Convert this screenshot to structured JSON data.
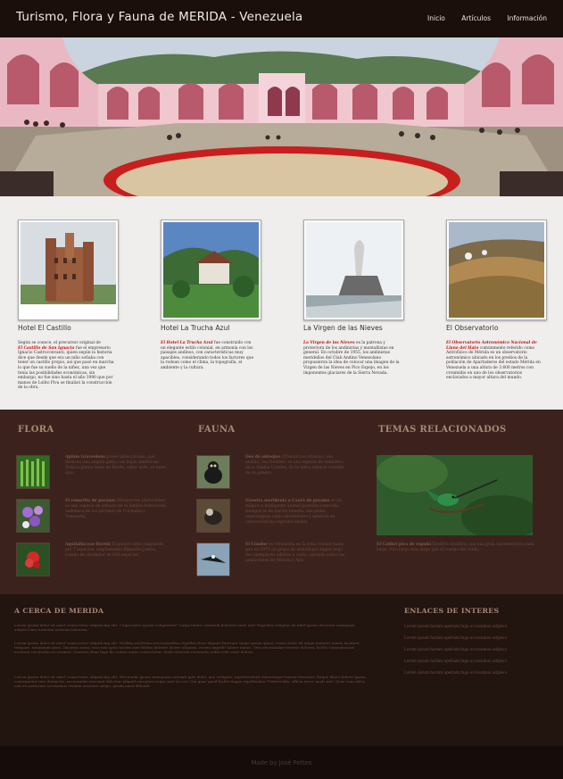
{
  "header": {
    "title": "Turismo, Flora y Fauna de MERIDA - Venezuela",
    "nav": [
      "Inicio",
      "Artículos",
      "Información"
    ]
  },
  "hotels": [
    {
      "name": "Hotel El Castillo",
      "pre": "Según se conoce, el precursor original de",
      "highlight": "El Castillo de San Ignacio",
      "post": "fue el empresario Ignacio Castroconvanti, quien según la historia dice que desde que era un niño soñaba con tener un castillo propio, así que pasó en marcha lo que fue su sueño de la niñez, una vez que tenía las posibilidades económicas, sin embargo, no fue sino hasta el año 1990 que por manos de Lolito Piva se finalizó la construcción de la obra."
    },
    {
      "name": "Hotel La Trucha Azul",
      "pre": "",
      "highlight": "El Hotel La Trucha Azul",
      "post": "fue construido con un elegante estilo colonial, en armonía con los paisajes andinos, con características muy apacibles, considerando todos los factores que la rodean como el clima, la topografía, el ambiente y la cultura."
    },
    {
      "name": "La Virgen de las Nieves",
      "pre": "",
      "highlight": "La Virgen de las Nieves",
      "post": "es la patrona y protectora de los andinistas y montañistas en general. En octubre de 1955, los andinistas merideños del Club Andino Venezolano propusieron la idea de colocar una imagen de la Virgen de las Nieves en Pico Espejo, en los imponentes glaciares de la Sierra Nevada."
    },
    {
      "name": "El Observatorio",
      "pre": "",
      "highlight": "El Observatorio Astronómico Nacional de Llano del Hato",
      "post": "comúnmente referido como Astrofísico de Mérida es un observatorio astronómico ubicado en los predios de la población de Apartaderos del estado Mérida en Venezuela a una altura de 3.600 metros con cronmidio en uno de los observatorios enclavados a mayor altura del mundo."
    }
  ],
  "sections": {
    "flora_title": "FLORA",
    "fauna_title": "FAUNA",
    "temas_title": "TEMAS RELACIONADOS"
  },
  "flora": [
    {
      "title": "Apium Graveolens",
      "text": "posee tallos rizosos, que florecen una amplia gama con hojas simétricas, Toda la planta tiene un fuerte, sabor acre, se tiene, apio."
    },
    {
      "title": "El romerito de páramo",
      "text": "(Hesperotes phylicoides) es una especie de arbusto de la familia Asteraceae, endémica de los páramos de Colombia y Venezuela."
    },
    {
      "title": "Aquilaliaceae Rerebi",
      "text": "El género está compuesto por 7 especies, ampliamente Ramados juntos, rosado de alrededor de 600 especies."
    }
  ],
  "fauna": [
    {
      "title": "Oso de anteojos",
      "text": "(Tremarctos ornatus), oso andino, oso frontino, es una especie de mamífero de la familia Ursidae. Es la única especie viviente de su género."
    },
    {
      "title": "Nuestra meridenia o Cauró de páramo",
      "text": "es un mágico e inteligente animal parecido conocido, siempre es de mucho tamaño, sus pieles neurológicas como alrededores y médicos en características reproducidades."
    },
    {
      "title": "El Cóndor",
      "text": "en Venezuela en la zona oriente hasta que en 1970 un grupo de ornitólogos inglés trajo dos ejemplares adultos a vuelo, cayendo sobre las poblaciones de Mérida y Apú."
    }
  ],
  "temas": {
    "title": "El Colibrí pico de espada",
    "text": "Ensiféra ensiféra, son una gran característica cada largo. Pico largo más largo que el cuerpo del cuello."
  },
  "about": {
    "title": "A CERCA DE MERIDA",
    "p1": "Lorem ipsum dolor sit amet consectetur adipisicing elit. Culpa natus ipsum voluptatem? Culpa totam commodi dolorem unde nisi! Expedita voluptas ab nihil ipsum deserunt numquam adipisci iure nostrum nostrum laborum.",
    "p2": "Lorem ipsum dolor sit amet consectetur adipisicing elit. Mollitia molestias necessitatibus repellat error aliquid deserunt saepe ipsum quasi, consectetur ab atque maiores omnis incidunt tempore, numquam quas. Ducimus nemo esse nisi optio harum sint debitis deleniti facere aliquam, rerum impedit labore minus. Vero recusandae tenetur dolores, facilis consequuntur nostrum reiciendis accusamus! Quaerat illum fuga hic soluta natus consectetur. Modi dolorum reiciendis nobis velit vitae dolore.",
    "p3": "Lorem ipsum dolor sit amet consectetur adipisicing elit. Reiciendis ipsum numquam corrupti quis dolor, quo voluptas, reprehenderit doloremque harum deserunt. Eaque libero labore ipsam, consequatur iure distinctio, recusandae nesciunt delectus aliquid excepturi sequi sunt ea eos! Qui quae quod facilis itaque repellendus! Perferendis, officia error, modi sint! Quae eum dolor non ex molestiae accusamus veniam nesciunt saepe, ipsum amet deleniti."
  },
  "links": {
    "title": "ENLACES DE INTERES",
    "items": [
      "Lorem ipsum harum aperiam fuga accusamus adipisci",
      "Lorem ipsum harum aperiam fuga accusamus adipisci",
      "Lorem ipsum harum aperiam fuga accusamus adipisci",
      "Lorem ipsum harum aperiam fuga accusamus adipisci",
      "Lorem ipsum harum aperiam fuga accusamus adipisci"
    ]
  },
  "footer": {
    "text": "Made by José Fettes"
  }
}
